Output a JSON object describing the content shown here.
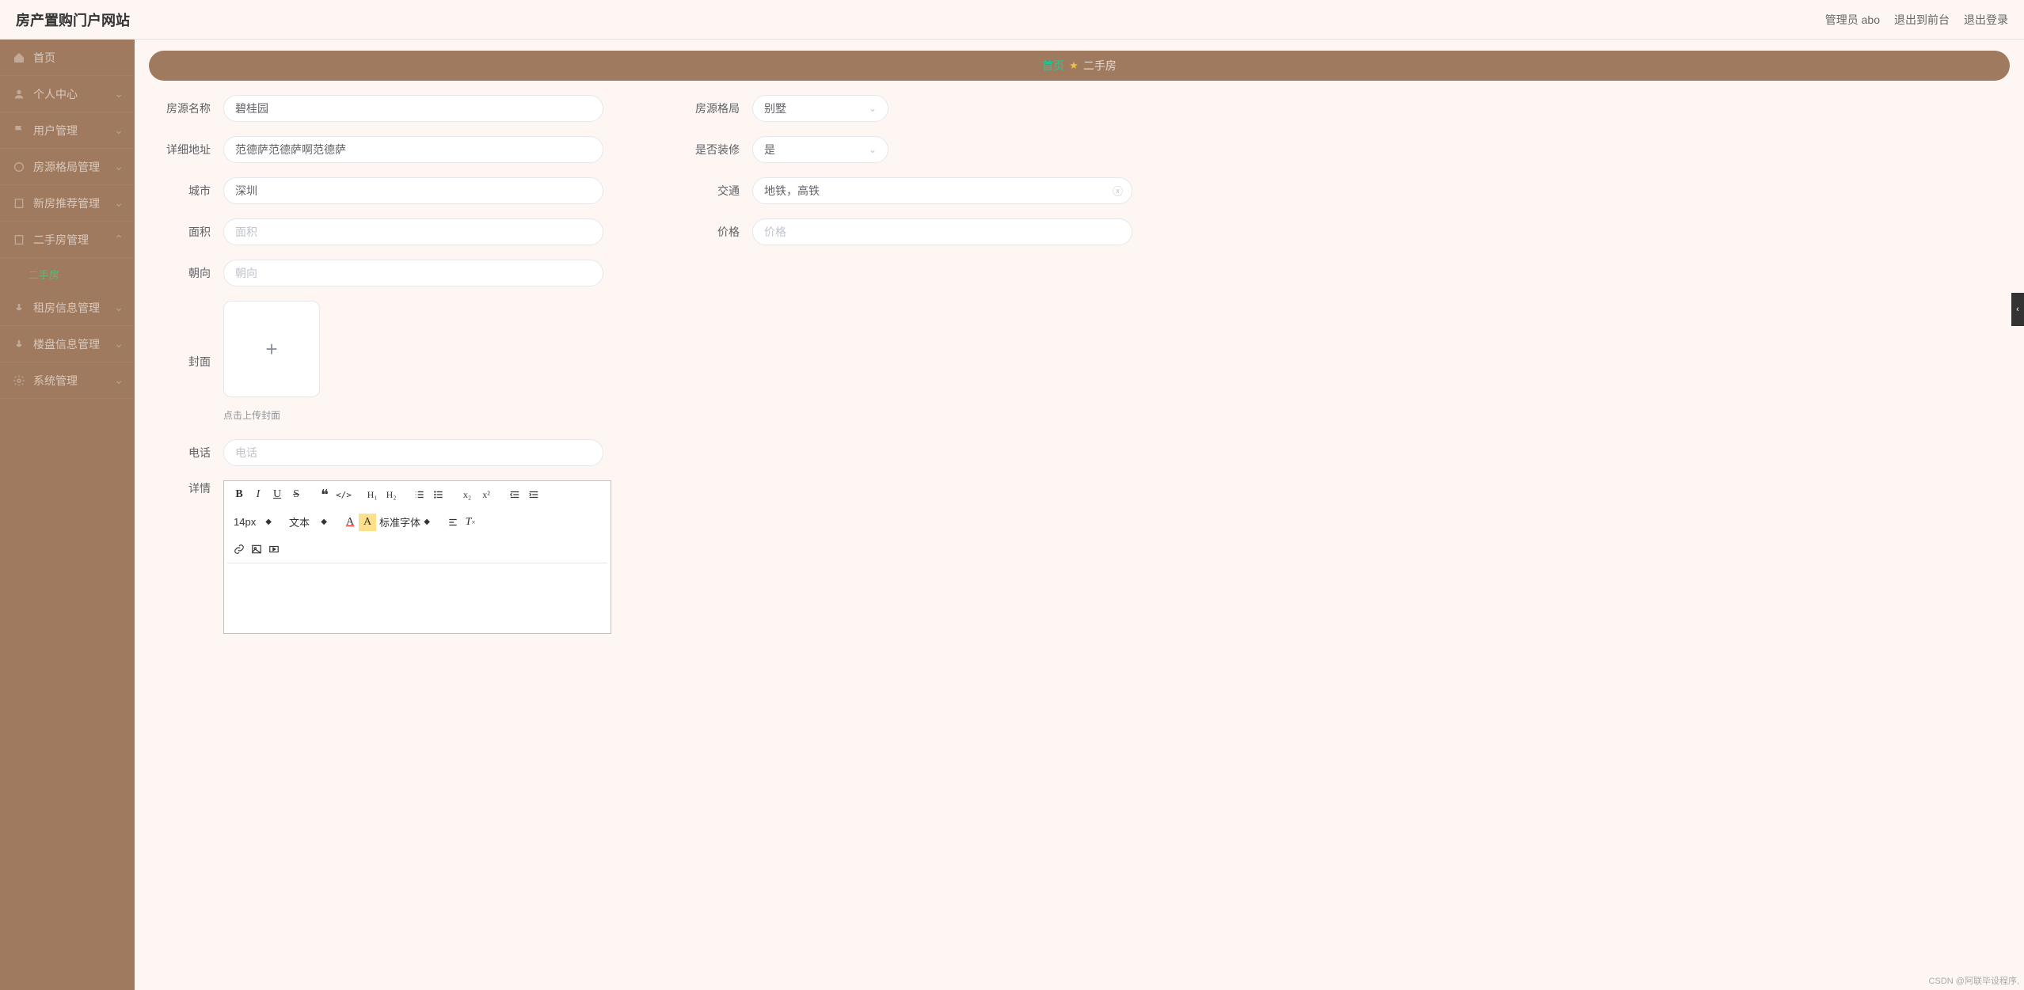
{
  "header": {
    "title": "房产置购门户网站",
    "links": {
      "admin": "管理员 abo",
      "back_front": "退出到前台",
      "logout": "退出登录"
    }
  },
  "sidebar": {
    "items": [
      {
        "label": "首页",
        "icon": "home"
      },
      {
        "label": "个人中心",
        "icon": "user"
      },
      {
        "label": "用户管理",
        "icon": "flag"
      },
      {
        "label": "房源格局管理",
        "icon": "circle"
      },
      {
        "label": "新房推荐管理",
        "icon": "doc"
      },
      {
        "label": "二手房管理",
        "icon": "doc",
        "children": [
          {
            "label": "二手房"
          }
        ]
      },
      {
        "label": "租房信息管理",
        "icon": "mic"
      },
      {
        "label": "楼盘信息管理",
        "icon": "mic"
      },
      {
        "label": "系统管理",
        "icon": "gear"
      }
    ]
  },
  "breadcrumb": {
    "home": "首页",
    "current": "二手房"
  },
  "form": {
    "left": {
      "name": {
        "label": "房源名称",
        "value": "碧桂园"
      },
      "address": {
        "label": "详细地址",
        "value": "范德萨范德萨啊范德萨"
      },
      "city": {
        "label": "城市",
        "value": "深圳"
      },
      "area": {
        "label": "面积",
        "value": "",
        "placeholder": "面积"
      },
      "orientation": {
        "label": "朝向",
        "value": "",
        "placeholder": "朝向"
      },
      "cover": {
        "label": "封面",
        "hint": "点击上传封面"
      },
      "phone": {
        "label": "电话",
        "value": "",
        "placeholder": "电话"
      },
      "details": {
        "label": "详情"
      }
    },
    "right": {
      "layout": {
        "label": "房源格局",
        "value": "别墅"
      },
      "renovated": {
        "label": "是否装修",
        "value": "是"
      },
      "transport": {
        "label": "交通",
        "value": "地铁，高铁"
      },
      "price": {
        "label": "价格",
        "value": "",
        "placeholder": "价格"
      }
    }
  },
  "editor": {
    "font_size": "14px",
    "text_label": "文本",
    "font_family": "标准字体"
  },
  "watermark": "CSDN @阿联毕设程序,"
}
